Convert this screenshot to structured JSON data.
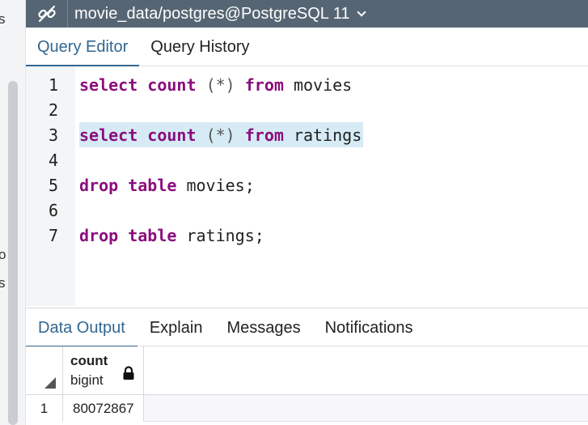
{
  "sidebar_fragments": [
    "s",
    "o",
    "s"
  ],
  "connection": {
    "title": "movie_data/postgres@PostgreSQL 11",
    "icon": "server-connect-icon"
  },
  "query_tabs": [
    {
      "label": "Query Editor",
      "active": true
    },
    {
      "label": "Query History",
      "active": false
    }
  ],
  "editor": {
    "lines": [
      {
        "number": "1",
        "tokens": [
          [
            "kw",
            "select"
          ],
          [
            "plain",
            " "
          ],
          [
            "kw",
            "count"
          ],
          [
            "plain",
            " "
          ],
          [
            "punc",
            "(*)"
          ],
          [
            "plain",
            " "
          ],
          [
            "kw",
            "from"
          ],
          [
            "plain",
            " movies"
          ]
        ],
        "highlight": false
      },
      {
        "number": "2",
        "tokens": [],
        "highlight": false
      },
      {
        "number": "3",
        "tokens": [
          [
            "kw",
            "select"
          ],
          [
            "plain",
            " "
          ],
          [
            "kw",
            "count"
          ],
          [
            "plain",
            " "
          ],
          [
            "punc",
            "(*)"
          ],
          [
            "plain",
            " "
          ],
          [
            "kw",
            "from"
          ],
          [
            "plain",
            " ratings"
          ]
        ],
        "highlight": true
      },
      {
        "number": "4",
        "tokens": [],
        "highlight": false
      },
      {
        "number": "5",
        "tokens": [
          [
            "kw",
            "drop"
          ],
          [
            "plain",
            " "
          ],
          [
            "kw",
            "table"
          ],
          [
            "plain",
            " movies;"
          ]
        ],
        "highlight": false
      },
      {
        "number": "6",
        "tokens": [],
        "highlight": false
      },
      {
        "number": "7",
        "tokens": [
          [
            "kw",
            "drop"
          ],
          [
            "plain",
            " "
          ],
          [
            "kw",
            "table"
          ],
          [
            "plain",
            " ratings;"
          ]
        ],
        "highlight": false
      }
    ]
  },
  "result_tabs": [
    {
      "label": "Data Output",
      "active": true
    },
    {
      "label": "Explain",
      "active": false
    },
    {
      "label": "Messages",
      "active": false
    },
    {
      "label": "Notifications",
      "active": false
    }
  ],
  "grid": {
    "column": {
      "name": "count",
      "type": "bigint",
      "icon": "lock-icon"
    },
    "rows": [
      {
        "index": "1",
        "value": "80072867"
      }
    ]
  },
  "colors": {
    "header_bar": "#566573",
    "active_tab": "#326690",
    "keyword": "#8a0e7d",
    "line_highlight": "#d6ebf5"
  }
}
